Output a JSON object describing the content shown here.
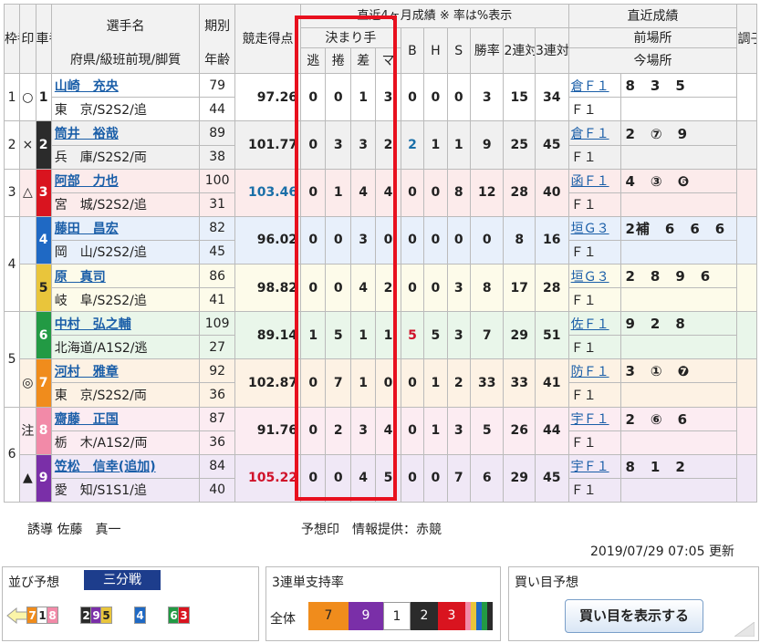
{
  "header": {
    "waku": "枠番",
    "shirushi": "印",
    "sha": "車番",
    "name_col": "選手名",
    "pref_col": "府県/級班前現/脚質",
    "ki": "期別",
    "age": "年齢",
    "score": "競走得点",
    "recent_title": "直近4ヶ月成績 ※ 率は%表示",
    "kimarite": "決まり手",
    "kimarite_cols": [
      "逃",
      "捲",
      "差",
      "マ"
    ],
    "bhs": [
      "B",
      "H",
      "S"
    ],
    "win": "勝率",
    "ren2": "2連対率",
    "ren3": "3連対率",
    "latest": "直近成績",
    "prev_venue": "前場所",
    "cur_venue": "今場所",
    "condition": "調子"
  },
  "racers": [
    {
      "waku": "1",
      "mark": "○",
      "car": "1",
      "name": "山崎　充央",
      "pref": "東　京/S2S2/追",
      "ki": "79",
      "age": "44",
      "score": "97.26",
      "score_color": "normal",
      "k": [
        "0",
        "0",
        "1",
        "3"
      ],
      "bhs": [
        "0",
        "0",
        "0"
      ],
      "b_color": "normal",
      "win": "3",
      "r2": "15",
      "r3": "34",
      "venue": "倉Ｆ１",
      "results": "8　3　5",
      "cur": "Ｆ１"
    },
    {
      "waku": "2",
      "mark": "×",
      "car": "2",
      "name": "筒井　裕哉",
      "pref": "兵　庫/S2S2/両",
      "ki": "89",
      "age": "38",
      "score": "101.77",
      "score_color": "normal",
      "k": [
        "0",
        "3",
        "3",
        "2"
      ],
      "bhs": [
        "2",
        "1",
        "1"
      ],
      "b_color": "blue",
      "win": "9",
      "r2": "25",
      "r3": "45",
      "venue": "倉Ｆ１",
      "results": "2　⑦　9",
      "cur": "Ｆ１"
    },
    {
      "waku": "3",
      "mark": "△",
      "car": "3",
      "name": "阿部　力也",
      "pref": "宮　城/S2S2/追",
      "ki": "100",
      "age": "31",
      "score": "103.46",
      "score_color": "blue",
      "k": [
        "0",
        "1",
        "4",
        "4"
      ],
      "bhs": [
        "0",
        "0",
        "8"
      ],
      "b_color": "normal",
      "win": "12",
      "r2": "28",
      "r3": "40",
      "venue": "函Ｆ１",
      "results": "4　③　❻",
      "cur": "Ｆ１"
    },
    {
      "waku": "4",
      "mark": "",
      "car": "4",
      "name": "藤田　昌宏",
      "pref": "岡　山/S2S2/追",
      "ki": "82",
      "age": "45",
      "score": "96.02",
      "score_color": "normal",
      "k": [
        "0",
        "0",
        "3",
        "0"
      ],
      "bhs": [
        "0",
        "0",
        "0"
      ],
      "b_color": "normal",
      "win": "0",
      "r2": "8",
      "r3": "16",
      "venue": "垣Ｇ３",
      "results": "2補　6　6　6",
      "cur": "Ｆ１"
    },
    {
      "waku": "",
      "mark": "",
      "car": "5",
      "name": "原　真司",
      "pref": "岐　阜/S2S2/追",
      "ki": "86",
      "age": "41",
      "score": "98.82",
      "score_color": "normal",
      "k": [
        "0",
        "0",
        "4",
        "2"
      ],
      "bhs": [
        "0",
        "0",
        "3"
      ],
      "b_color": "normal",
      "win": "8",
      "r2": "17",
      "r3": "28",
      "venue": "垣Ｇ３",
      "results": "2　8　9　6",
      "cur": "Ｆ１"
    },
    {
      "waku": "5",
      "mark": "",
      "car": "6",
      "name": "中村　弘之輔",
      "pref": "北海道/A1S2/逃",
      "ki": "109",
      "age": "27",
      "score": "89.14",
      "score_color": "normal",
      "k": [
        "1",
        "5",
        "1",
        "1"
      ],
      "bhs": [
        "5",
        "5",
        "3"
      ],
      "b_color": "red",
      "win": "7",
      "r2": "29",
      "r3": "51",
      "venue": "佐Ｆ１",
      "results": "9　2　8",
      "cur": "Ｆ１"
    },
    {
      "waku": "",
      "mark": "◎",
      "car": "7",
      "name": "河村　雅章",
      "pref": "東　京/S2S2/両",
      "ki": "92",
      "age": "36",
      "score": "102.87",
      "score_color": "normal",
      "k": [
        "0",
        "7",
        "1",
        "0"
      ],
      "bhs": [
        "0",
        "1",
        "2"
      ],
      "b_color": "normal",
      "win": "33",
      "r2": "33",
      "r3": "41",
      "venue": "防Ｆ１",
      "results": "3　①　❼",
      "cur": "Ｆ１"
    },
    {
      "waku": "6",
      "mark": "注",
      "car": "8",
      "name": "齋藤　正国",
      "pref": "栃　木/A1S2/両",
      "ki": "87",
      "age": "36",
      "score": "91.76",
      "score_color": "normal",
      "k": [
        "0",
        "2",
        "3",
        "4"
      ],
      "bhs": [
        "0",
        "1",
        "3"
      ],
      "b_color": "normal",
      "win": "5",
      "r2": "26",
      "r3": "44",
      "venue": "宇Ｆ１",
      "results": "2　⑥　6",
      "cur": "Ｆ１"
    },
    {
      "waku": "",
      "mark": "▲",
      "car": "9",
      "name": "笠松　信幸(追加)",
      "pref": "愛　知/S1S1/追",
      "ki": "84",
      "age": "40",
      "score": "105.22",
      "score_color": "red",
      "k": [
        "0",
        "0",
        "4",
        "5"
      ],
      "bhs": [
        "0",
        "0",
        "7"
      ],
      "b_color": "normal",
      "win": "6",
      "r2": "29",
      "r3": "45",
      "venue": "宇Ｆ１",
      "results": "8　1　2",
      "cur": "Ｆ１"
    }
  ],
  "footer": {
    "guide": "誘導 佐藤　真一",
    "forecast": "予想印　情報提供：赤競",
    "updated": "2019/07/29 07:05 更新"
  },
  "lineup": {
    "title": "並び予想",
    "tag": "三分戦",
    "groups": [
      [
        "7",
        "1",
        "8"
      ],
      [
        "2",
        "9",
        "5"
      ],
      [
        "4"
      ],
      [
        "6",
        "3"
      ]
    ]
  },
  "support": {
    "title": "3連単支持率",
    "label": "全体",
    "cars": [
      "7",
      "9",
      "1",
      "2",
      "3"
    ]
  },
  "buy": {
    "title": "買い目予想",
    "button": "買い目を表示する"
  },
  "colors": {
    "highlight": "#e8101e",
    "link": "#1a5ea8",
    "tag": "#1d3d8c"
  }
}
